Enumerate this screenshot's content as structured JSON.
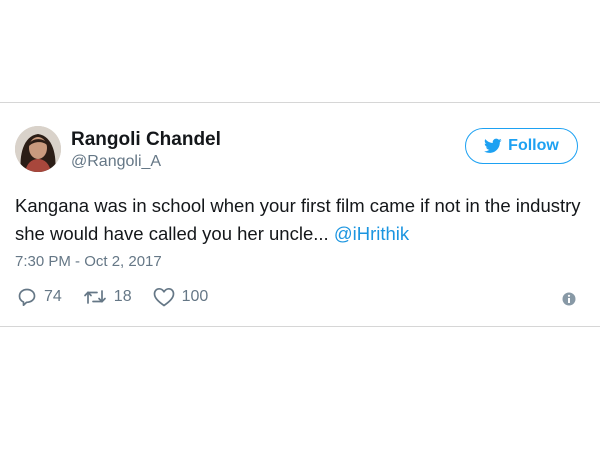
{
  "user": {
    "display_name": "Rangoli Chandel",
    "handle": "@Rangoli_A",
    "avatar_icon": "profile-photo"
  },
  "follow_button": {
    "label": "Follow",
    "icon": "twitter-bird-icon",
    "accent_color": "#1da1f2"
  },
  "tweet": {
    "text": "Kangana was in school when your first film came if not in the industry she would have called you her uncle... ",
    "mention": "@iHrithik",
    "timestamp": "7:30 PM - Oct 2, 2017"
  },
  "actions": {
    "reply_count": "74",
    "retweet_count": "18",
    "like_count": "100"
  },
  "colors": {
    "text_primary": "#14171a",
    "text_secondary": "#657786",
    "link": "#1b95e0",
    "divider": "#d6d6d6"
  }
}
